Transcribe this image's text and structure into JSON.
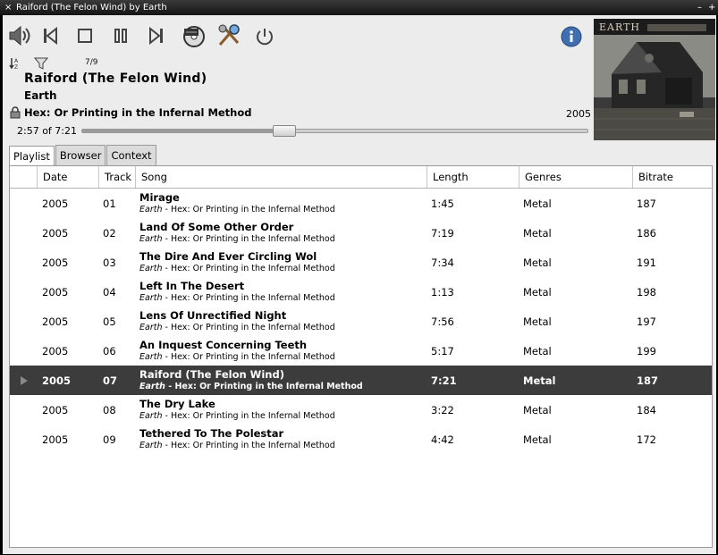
{
  "window": {
    "title": "Raiford (The Felon Wind) by Earth"
  },
  "toolbar": {
    "track_counter": "7/9"
  },
  "now_playing": {
    "title": "Raiford (The Felon Wind)",
    "artist": "Earth",
    "album": "Hex: Or Printing in the Infernal Method",
    "year": "2005",
    "time": "2:57 of 7:21",
    "progress": 0.4
  },
  "cover": {
    "band_text": "EARTH"
  },
  "tabs": [
    "Playlist",
    "Browser",
    "Context"
  ],
  "columns": [
    "Date",
    "Track",
    "Song",
    "Length",
    "Genres",
    "Bitrate"
  ],
  "tracks": [
    {
      "date": "2005",
      "track": "01",
      "song": "Mirage",
      "artist": "Earth",
      "album_suffix": " - Hex: Or Printing in the Infernal Method",
      "length": "1:45",
      "genre": "Metal",
      "bitrate": "187"
    },
    {
      "date": "2005",
      "track": "02",
      "song": "Land Of Some Other Order",
      "artist": "Earth",
      "album_suffix": " - Hex: Or Printing in the Infernal Method",
      "length": "7:19",
      "genre": "Metal",
      "bitrate": "186"
    },
    {
      "date": "2005",
      "track": "03",
      "song": "The Dire And Ever Circling Wol",
      "artist": "Earth",
      "album_suffix": " - Hex: Or Printing in the Infernal Method",
      "length": "7:34",
      "genre": "Metal",
      "bitrate": "191"
    },
    {
      "date": "2005",
      "track": "04",
      "song": "Left In The Desert",
      "artist": "Earth",
      "album_suffix": " - Hex: Or Printing in the Infernal Method",
      "length": "1:13",
      "genre": "Metal",
      "bitrate": "198"
    },
    {
      "date": "2005",
      "track": "05",
      "song": "Lens Of Unrectified Night",
      "artist": "Earth",
      "album_suffix": " - Hex: Or Printing in the Infernal Method",
      "length": "7:56",
      "genre": "Metal",
      "bitrate": "197"
    },
    {
      "date": "2005",
      "track": "06",
      "song": "An Inquest Concerning Teeth",
      "artist": "Earth",
      "album_suffix": " - Hex: Or Printing in the Infernal Method",
      "length": "5:17",
      "genre": "Metal",
      "bitrate": "199"
    },
    {
      "date": "2005",
      "track": "07",
      "song": "Raiford (The Felon Wind)",
      "artist": "Earth",
      "album_suffix": " - Hex: Or Printing in the Infernal Method",
      "length": "7:21",
      "genre": "Metal",
      "bitrate": "187",
      "playing": true
    },
    {
      "date": "2005",
      "track": "08",
      "song": "The Dry Lake",
      "artist": "Earth",
      "album_suffix": " - Hex: Or Printing in the Infernal Method",
      "length": "3:22",
      "genre": "Metal",
      "bitrate": "184"
    },
    {
      "date": "2005",
      "track": "09",
      "song": "Tethered To The Polestar",
      "artist": "Earth",
      "album_suffix": " - Hex: Or Printing in the Infernal Method",
      "length": "4:42",
      "genre": "Metal",
      "bitrate": "172"
    }
  ]
}
